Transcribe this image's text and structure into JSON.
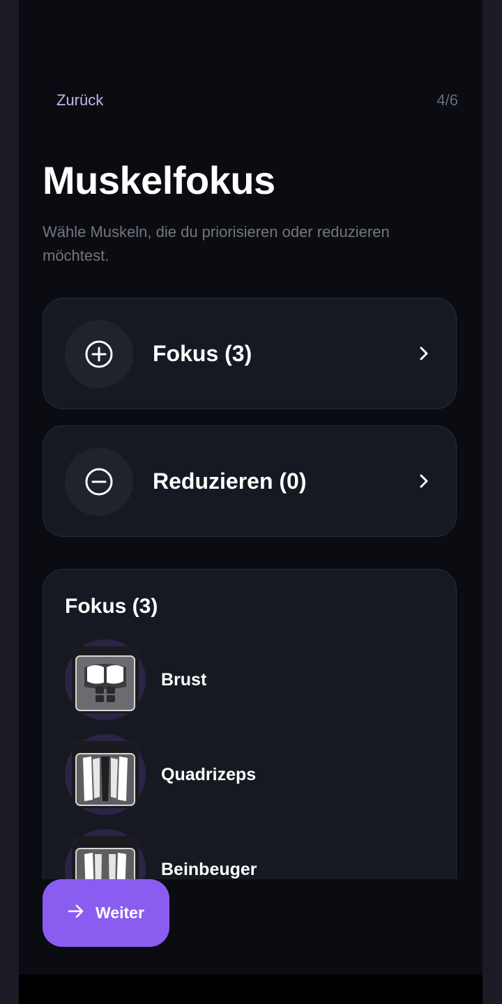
{
  "header": {
    "back_label": "Zurück",
    "step": "4/6"
  },
  "title": "Muskelfokus",
  "subtitle": "Wähle Muskeln, die du priorisieren oder reduzieren möchtest.",
  "options": [
    {
      "label": "Fokus (3)",
      "icon": "plus-circle-icon"
    },
    {
      "label": "Reduzieren (0)",
      "icon": "minus-circle-icon"
    }
  ],
  "focus_list": {
    "title": "Fokus (3)",
    "items": [
      {
        "name": "Brust",
        "icon": "chest-muscle-icon"
      },
      {
        "name": "Quadrizeps",
        "icon": "quadriceps-muscle-icon"
      },
      {
        "name": "Beinbeuger",
        "icon": "hamstrings-muscle-icon"
      }
    ]
  },
  "next_button": {
    "label": "Weiter",
    "icon": "arrow-right-icon"
  },
  "colors": {
    "accent": "#8b5cf0",
    "back_link": "#c7b4f3",
    "background": "#0b0c11",
    "card": "#171922"
  }
}
